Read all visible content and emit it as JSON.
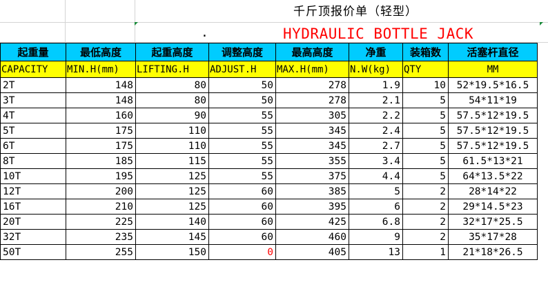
{
  "sheet": {
    "title_cn": "千斤顶报价单（轻型）",
    "title_en": "HYDRAULIC BOTTLE JACK",
    "marker": "."
  },
  "headers_cn": [
    "起重量",
    "最低高度",
    "起重高度",
    "调整高度",
    "最高高度",
    "净重",
    "装箱数",
    "活塞杆直径"
  ],
  "headers_en": [
    "CAPACITY",
    "MIN.H(mm)",
    "LIFTING.H",
    "ADJUST.H",
    "MAX.H(mm)",
    "N.W(kg)",
    "QTY",
    "MM"
  ],
  "rows": [
    {
      "capacity": "2T",
      "min_h": "148",
      "lifting_h": "80",
      "adjust_h": "50",
      "max_h": "278",
      "nw": "1.9",
      "qty": "10",
      "rod": "52*19.5*16.5"
    },
    {
      "capacity": "3T",
      "min_h": "148",
      "lifting_h": "80",
      "adjust_h": "50",
      "max_h": "278",
      "nw": "2.1",
      "qty": "5",
      "rod": "54*11*19"
    },
    {
      "capacity": "4T",
      "min_h": "160",
      "lifting_h": "90",
      "adjust_h": "55",
      "max_h": "305",
      "nw": "2.2",
      "qty": "5",
      "rod": "57.5*12*19.5"
    },
    {
      "capacity": "5T",
      "min_h": "175",
      "lifting_h": "110",
      "adjust_h": "55",
      "max_h": "345",
      "nw": "2.4",
      "qty": "5",
      "rod": "57.5*12*19.5"
    },
    {
      "capacity": "6T",
      "min_h": "175",
      "lifting_h": "110",
      "adjust_h": "55",
      "max_h": "345",
      "nw": "2.7",
      "qty": "5",
      "rod": "57.5*12*19.5"
    },
    {
      "capacity": "8T",
      "min_h": "185",
      "lifting_h": "115",
      "adjust_h": "55",
      "max_h": "355",
      "nw": "3.4",
      "qty": "5",
      "rod": "61.5*13*21"
    },
    {
      "capacity": "10T",
      "min_h": "195",
      "lifting_h": "125",
      "adjust_h": "55",
      "max_h": "375",
      "nw": "4.4",
      "qty": "5",
      "rod": "64*13.5*22"
    },
    {
      "capacity": "12T",
      "min_h": "200",
      "lifting_h": "125",
      "adjust_h": "60",
      "max_h": "385",
      "nw": "5",
      "qty": "2",
      "rod": "28*14*22"
    },
    {
      "capacity": "16T",
      "min_h": "210",
      "lifting_h": "125",
      "adjust_h": "60",
      "max_h": "395",
      "nw": "6",
      "qty": "2",
      "rod": "29*14.5*23"
    },
    {
      "capacity": "20T",
      "min_h": "225",
      "lifting_h": "140",
      "adjust_h": "60",
      "max_h": "425",
      "nw": "6.8",
      "qty": "2",
      "rod": "32*17*25.5"
    },
    {
      "capacity": "32T",
      "min_h": "235",
      "lifting_h": "145",
      "adjust_h": "60",
      "max_h": "460",
      "nw": "9",
      "qty": "2",
      "rod": "35*17*28"
    },
    {
      "capacity": "50T",
      "min_h": "255",
      "lifting_h": "150",
      "adjust_h": "0",
      "max_h": "405",
      "nw": "13",
      "qty": "1",
      "rod": "21*18*26.5"
    }
  ],
  "colors": {
    "header_cn_bg": "#00ccff",
    "header_en_bg": "#ffff00",
    "title_en": "#ff0000",
    "highlight_value": "#ff0000"
  }
}
